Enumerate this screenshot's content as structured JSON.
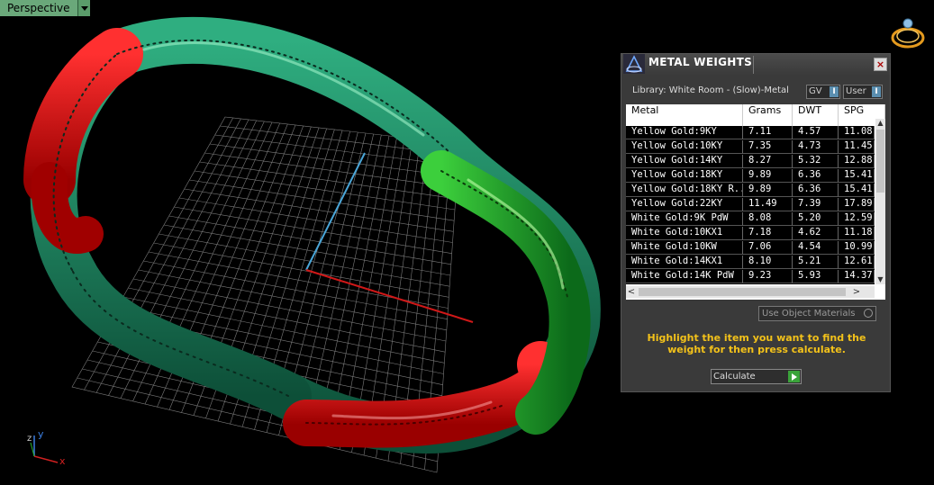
{
  "viewport": {
    "view_name": "Perspective"
  },
  "panel": {
    "title": "METAL WEIGHTS",
    "close_icon": "close-icon",
    "library_label": "Library: White Room - (Slow)-Metal",
    "gv_label": "GV",
    "user_label": "User",
    "columns": [
      "Metal",
      "Grams",
      "DWT",
      "SPG"
    ],
    "rows": [
      [
        "Yellow Gold:9KY",
        "7.11",
        "4.57",
        "11.08"
      ],
      [
        "Yellow Gold:10KY",
        "7.35",
        "4.73",
        "11.45"
      ],
      [
        "Yellow Gold:14KY",
        "8.27",
        "5.32",
        "12.88"
      ],
      [
        "Yellow Gold:18KY",
        "9.89",
        "6.36",
        "15.41"
      ],
      [
        "Yellow Gold:18KY R...",
        "9.89",
        "6.36",
        "15.41"
      ],
      [
        "Yellow Gold:22KY",
        "11.49",
        "7.39",
        "17.89"
      ],
      [
        "White Gold:9K PdW",
        "8.08",
        "5.20",
        "12.59"
      ],
      [
        "White Gold:10KX1",
        "7.18",
        "4.62",
        "11.18"
      ],
      [
        "White Gold:10KW",
        "7.06",
        "4.54",
        "10.99"
      ],
      [
        "White Gold:14KX1",
        "8.10",
        "5.21",
        "12.61"
      ],
      [
        "White Gold:14K PdW",
        "9.23",
        "5.93",
        "14.37"
      ]
    ],
    "use_object_materials": "Use Object Materials",
    "hint": "Highlight the item you want to find the weight for then press calculate.",
    "calculate": "Calculate"
  },
  "axes": {
    "x": "x",
    "y": "y",
    "z": "z"
  },
  "colors": {
    "red_metal": "#e01010",
    "green_metal": "#1f8a5c",
    "grid": "#8a8a8a",
    "hint": "#f3c21a"
  }
}
